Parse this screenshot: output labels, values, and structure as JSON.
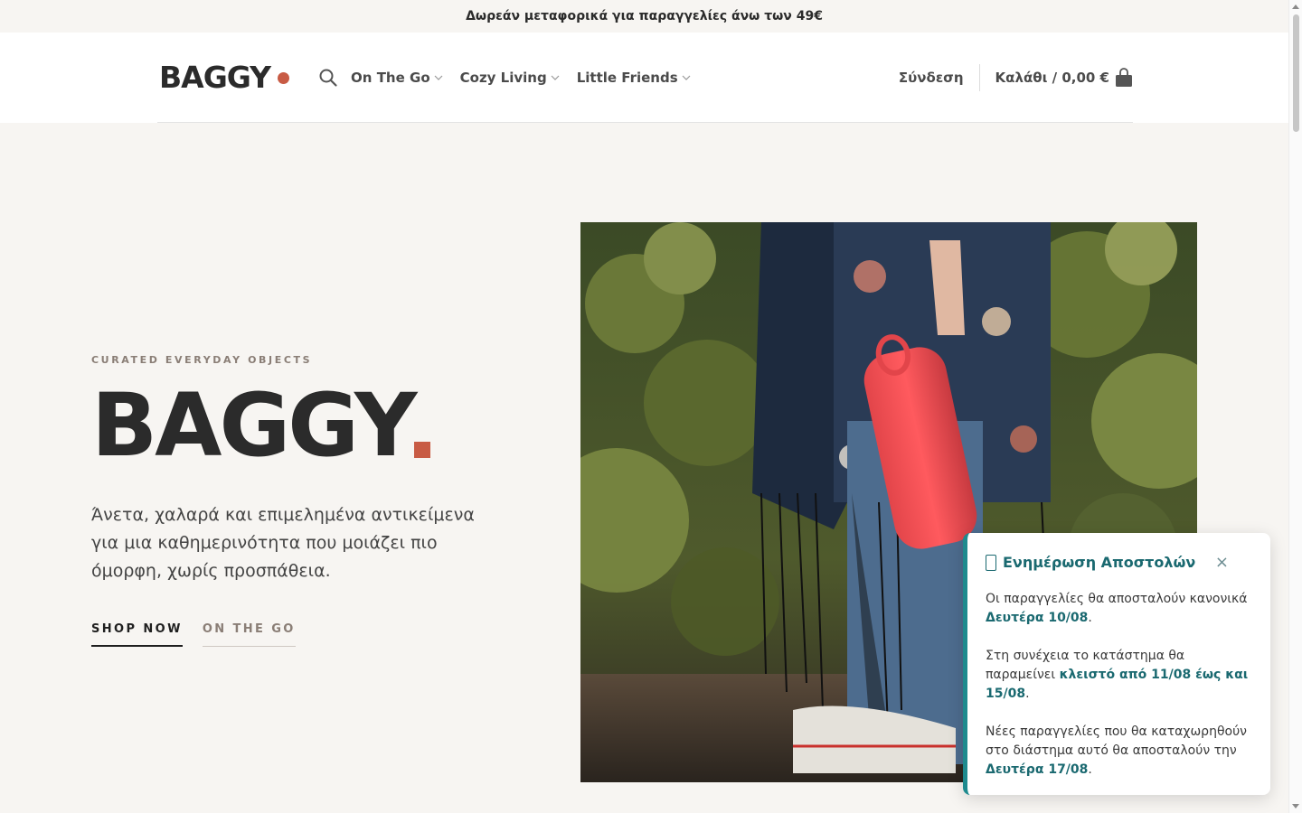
{
  "topbar": {
    "text": "Δωρεάν μεταφορικά για παραγγελίες άνω των 49€"
  },
  "header": {
    "logo": "BAGGY",
    "nav": [
      {
        "label": "On The Go"
      },
      {
        "label": "Cozy Living"
      },
      {
        "label": "Little Friends"
      }
    ],
    "login": "Σύνδεση",
    "cart": "Καλάθι / 0,00 €"
  },
  "hero": {
    "eyebrow": "CURATED EVERYDAY OBJECTS",
    "title": "BAGGY",
    "description": "Άνετα, χαλαρά και επιμελημένα αντικείμενα για μια καθημερινότητα που μοιάζει πιο όμορφη, χωρίς προσπάθεια.",
    "primary_cta": "SHOP NOW",
    "secondary_cta": "ON THE GO"
  },
  "popup": {
    "title": "Ενημέρωση Αποστολών",
    "close": "×",
    "p1_text": "Οι παραγγελίες θα αποσταλούν κανονικά ",
    "p1_hl": "Δευτέρα 10/08",
    "p1_end": ".",
    "p2_text": "Στη συνέχεια το κατάστημα θα παραμείνει ",
    "p2_hl": "κλειστό από 11/08 έως και 15/08",
    "p2_end": ".",
    "p3_text": "Νέες παραγγελίες που θα καταχωρηθούν στο διάστημα αυτό θα αποσταλούν την ",
    "p3_hl": "Δευτέρα 17/08",
    "p3_end": "."
  },
  "colors": {
    "accent": "#c85b44",
    "popup_accent": "#1e8a8e",
    "background": "#f7f5f2"
  }
}
